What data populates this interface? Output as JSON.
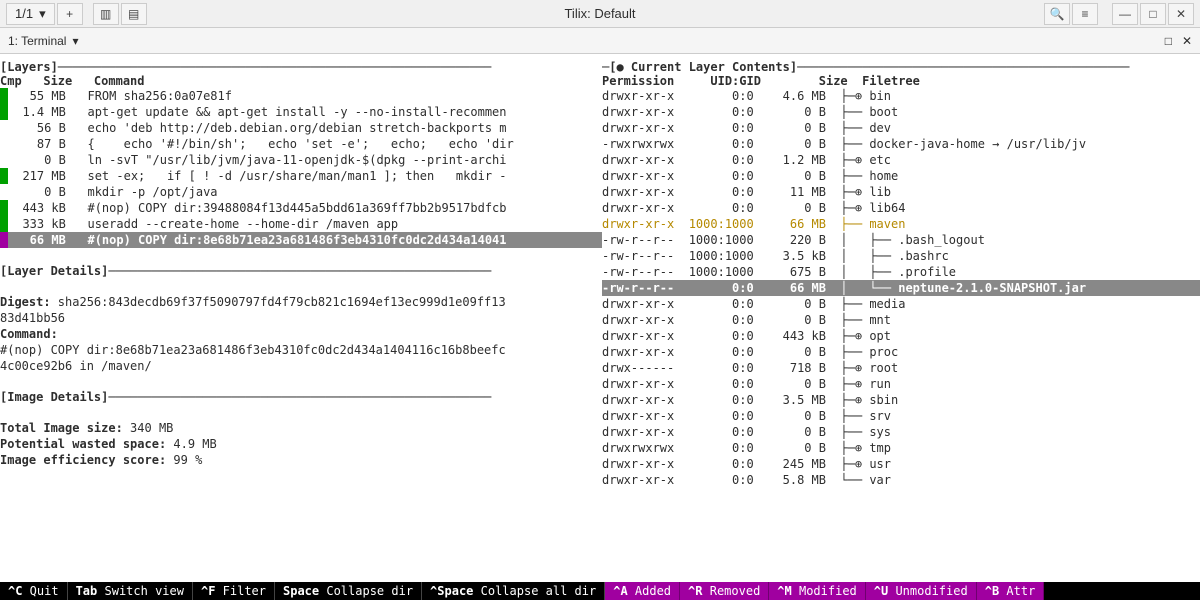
{
  "titlebar": {
    "session": "1/1",
    "title": "Tilix: Default"
  },
  "tabbar": {
    "tab": "1: Terminal"
  },
  "left": {
    "section_layers": "[Layers]────────────────────────────────────────────────────────────",
    "header": "Cmp   Size   Command",
    "rows": [
      {
        "bar": "green",
        "text": "   55 MB   FROM sha256:0a07e81f"
      },
      {
        "bar": "green",
        "text": "  1.4 MB   apt-get update && apt-get install -y --no-install-recommen"
      },
      {
        "bar": "none",
        "text": "    56 B   echo 'deb http://deb.debian.org/debian stretch-backports m"
      },
      {
        "bar": "none",
        "text": "    87 B   {    echo '#!/bin/sh';   echo 'set -e';   echo;   echo 'dir"
      },
      {
        "bar": "none",
        "text": "     0 B   ln -svT \"/usr/lib/jvm/java-11-openjdk-$(dpkg --print-archi"
      },
      {
        "bar": "green",
        "text": "  217 MB   set -ex;   if [ ! -d /usr/share/man/man1 ]; then   mkdir -"
      },
      {
        "bar": "none",
        "text": "     0 B   mkdir -p /opt/java"
      },
      {
        "bar": "green",
        "text": "  443 kB   #(nop) COPY dir:39488084f13d445a5bdd61a369ff7bb2b9517bdfcb"
      },
      {
        "bar": "green",
        "text": "  333 kB   useradd --create-home --home-dir /maven app"
      }
    ],
    "selected": {
      "bar": "purple",
      "text": "   66 MB   #(nop) COPY dir:8e68b71ea23a681486f3eb4310fc0dc2d434a14041"
    },
    "section_details": "[Layer Details]─────────────────────────────────────────────────────",
    "digest_label": "Digest:",
    "digest_val": " sha256:843decdb69f37f5090797fd4f79cb821c1694ef13ec999d1e09ff13",
    "digest_val2": "83d41bb56",
    "command_label": "Command:",
    "command_val": "#(nop) COPY dir:8e68b71ea23a681486f3eb4310fc0dc2d434a1404116c16b8beefc",
    "command_val2": "4c00ce92b6 in /maven/",
    "section_image": "[Image Details]─────────────────────────────────────────────────────",
    "total_label": "Total Image size:",
    "total_val": " 340 MB",
    "wasted_label": "Potential wasted space:",
    "wasted_val": " 4.9 MB",
    "eff_label": "Image efficiency score:",
    "eff_val": " 99 %"
  },
  "right": {
    "section": "─[● Current Layer Contents]──────────────────────────────────────────────",
    "header": "Permission     UID:GID        Size  Filetree",
    "rows": [
      {
        "p": "drwxr-xr-x",
        "u": "        0:0",
        "s": "    4.6 MB",
        "f": "  ├─⊕ bin",
        "cls": ""
      },
      {
        "p": "drwxr-xr-x",
        "u": "        0:0",
        "s": "       0 B",
        "f": "  ├── boot",
        "cls": ""
      },
      {
        "p": "drwxr-xr-x",
        "u": "        0:0",
        "s": "       0 B",
        "f": "  ├── dev",
        "cls": ""
      },
      {
        "p": "-rwxrwxrwx",
        "u": "        0:0",
        "s": "       0 B",
        "f": "  ├── docker-java-home → /usr/lib/jv",
        "cls": ""
      },
      {
        "p": "drwxr-xr-x",
        "u": "        0:0",
        "s": "    1.2 MB",
        "f": "  ├─⊕ etc",
        "cls": ""
      },
      {
        "p": "drwxr-xr-x",
        "u": "        0:0",
        "s": "       0 B",
        "f": "  ├── home",
        "cls": ""
      },
      {
        "p": "drwxr-xr-x",
        "u": "        0:0",
        "s": "     11 MB",
        "f": "  ├─⊕ lib",
        "cls": ""
      },
      {
        "p": "drwxr-xr-x",
        "u": "        0:0",
        "s": "       0 B",
        "f": "  ├─⊕ lib64",
        "cls": ""
      },
      {
        "p": "drwxr-xr-x",
        "u": "  1000:1000",
        "s": "     66 MB",
        "f": "  ├── maven",
        "cls": "orange"
      },
      {
        "p": "-rw-r--r--",
        "u": "  1000:1000",
        "s": "     220 B",
        "f": "  │   ├── .bash_logout",
        "cls": ""
      },
      {
        "p": "-rw-r--r--",
        "u": "  1000:1000",
        "s": "    3.5 kB",
        "f": "  │   ├── .bashrc",
        "cls": ""
      },
      {
        "p": "-rw-r--r--",
        "u": "  1000:1000",
        "s": "     675 B",
        "f": "  │   ├── .profile",
        "cls": ""
      }
    ],
    "selected": {
      "p": "-rw-r--r--",
      "u": "        0:0",
      "s": "     66 MB",
      "f": "  │   └── neptune-2.1.0-SNAPSHOT.jar"
    },
    "rows2": [
      {
        "p": "drwxr-xr-x",
        "u": "        0:0",
        "s": "       0 B",
        "f": "  ├── media",
        "cls": ""
      },
      {
        "p": "drwxr-xr-x",
        "u": "        0:0",
        "s": "       0 B",
        "f": "  ├── mnt",
        "cls": ""
      },
      {
        "p": "drwxr-xr-x",
        "u": "        0:0",
        "s": "    443 kB",
        "f": "  ├─⊕ opt",
        "cls": ""
      },
      {
        "p": "drwxr-xr-x",
        "u": "        0:0",
        "s": "       0 B",
        "f": "  ├── proc",
        "cls": ""
      },
      {
        "p": "drwx------",
        "u": "        0:0",
        "s": "     718 B",
        "f": "  ├─⊕ root",
        "cls": ""
      },
      {
        "p": "drwxr-xr-x",
        "u": "        0:0",
        "s": "       0 B",
        "f": "  ├─⊕ run",
        "cls": ""
      },
      {
        "p": "drwxr-xr-x",
        "u": "        0:0",
        "s": "    3.5 MB",
        "f": "  ├─⊕ sbin",
        "cls": ""
      },
      {
        "p": "drwxr-xr-x",
        "u": "        0:0",
        "s": "       0 B",
        "f": "  ├── srv",
        "cls": ""
      },
      {
        "p": "drwxr-xr-x",
        "u": "        0:0",
        "s": "       0 B",
        "f": "  ├── sys",
        "cls": ""
      },
      {
        "p": "drwxrwxrwx",
        "u": "        0:0",
        "s": "       0 B",
        "f": "  ├─⊕ tmp",
        "cls": ""
      },
      {
        "p": "drwxr-xr-x",
        "u": "        0:0",
        "s": "    245 MB",
        "f": "  ├─⊕ usr",
        "cls": ""
      },
      {
        "p": "drwxr-xr-x",
        "u": "        0:0",
        "s": "    5.8 MB",
        "f": "  └── var",
        "cls": ""
      }
    ]
  },
  "footer": {
    "items": [
      {
        "k": "^C",
        "v": " Quit"
      },
      {
        "k": "Tab",
        "v": " Switch view"
      },
      {
        "k": "^F",
        "v": " Filter"
      },
      {
        "k": "Space",
        "v": " Collapse dir"
      },
      {
        "k": "^Space",
        "v": " Collapse all dir"
      }
    ],
    "mitems": [
      {
        "k": "^A",
        "v": " Added"
      },
      {
        "k": "^R",
        "v": " Removed"
      },
      {
        "k": "^M",
        "v": " Modified"
      },
      {
        "k": "^U",
        "v": " Unmodified"
      },
      {
        "k": "^B",
        "v": " Attr"
      }
    ]
  }
}
